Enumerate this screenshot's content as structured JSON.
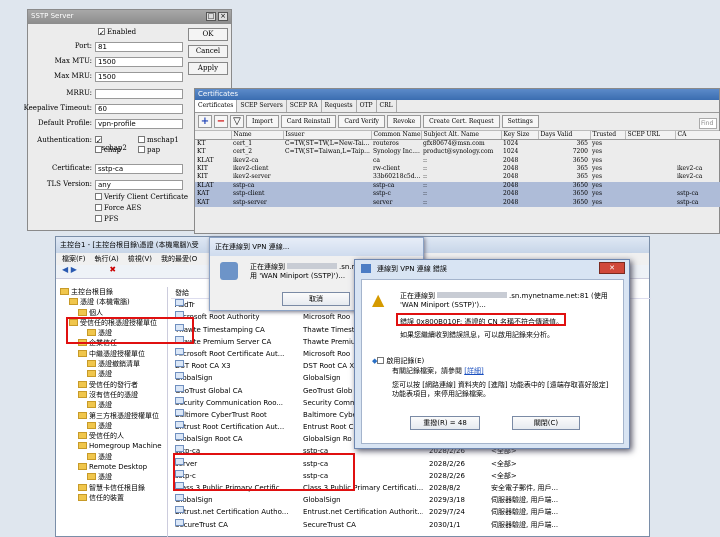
{
  "sstp": {
    "title": "SSTP Server",
    "enabled_label": "Enabled",
    "port_label": "Port:",
    "port": "81",
    "max_mtu_label": "Max MTU:",
    "max_mtu": "1500",
    "max_mru_label": "Max MRU:",
    "max_mru": "1500",
    "mrru_label": "MRRU:",
    "keepalive_label": "Keepalive Timeout:",
    "keepalive": "60",
    "default_profile_label": "Default Profile:",
    "default_profile": "vpn-profile",
    "auth_label": "Authentication:",
    "auth_mschap2": "mschap2",
    "auth_mschap1": "mschap1",
    "auth_chap": "chap",
    "auth_pap": "pap",
    "certificate_label": "Certificate:",
    "certificate": "sstp-ca",
    "tls_label": "TLS Version:",
    "tls": "any",
    "verify_label": "Verify Client Certificate",
    "force_aes_label": "Force AES",
    "pfs_label": "PFS",
    "ok": "OK",
    "cancel": "Cancel",
    "apply": "Apply"
  },
  "certs": {
    "title": "Certificates",
    "tabs": [
      "Certificates",
      "SCEP Servers",
      "SCEP RA",
      "Requests",
      "OTP",
      "CRL"
    ],
    "buttons": [
      "Import",
      "Card Reinstall",
      "Card Verify",
      "Revoke",
      "Create Cert. Request",
      "Settings"
    ],
    "find": "Find",
    "columns": [
      "",
      "Name",
      "Issuer",
      "Common Name",
      "Subject Alt. Name",
      "Key Size",
      "Days Valid",
      "Trusted",
      "SCEP URL",
      "CA"
    ],
    "rows": [
      [
        "KT",
        "cert_1",
        "C=TW,ST=TW,L=New-Tai...",
        "routeros",
        "gfx80674@msn.com",
        "1024",
        "365",
        "yes",
        "",
        ""
      ],
      [
        "KT",
        "cert_2",
        "C=TW,ST=Taiwan,L=Taip...",
        "Synology Inc....",
        "product@synology.com",
        "1024",
        "7200",
        "yes",
        "",
        ""
      ],
      [
        "KLAT",
        "ikev2-ca",
        "",
        "ca",
        "::",
        "2048",
        "3650",
        "yes",
        "",
        ""
      ],
      [
        "KIT",
        "ikev2-client",
        "",
        "rw-client",
        "::",
        "2048",
        "365",
        "yes",
        "",
        "ikev2-ca"
      ],
      [
        "KIT",
        "ikev2-server",
        "",
        "33b60218c5d...",
        "::",
        "2048",
        "365",
        "yes",
        "",
        "ikev2-ca"
      ],
      [
        "KLAT",
        "sstp-ca",
        "",
        "sstp-ca",
        "::",
        "2048",
        "3650",
        "yes",
        "",
        ""
      ],
      [
        "KAT",
        "sstp-client",
        "",
        "sstp-c",
        "::",
        "2048",
        "3650",
        "yes",
        "",
        "sstp-ca"
      ],
      [
        "KAT",
        "sstp-server",
        "",
        "server",
        "::",
        "2048",
        "3650",
        "yes",
        "",
        "sstp-ca"
      ]
    ]
  },
  "mmc": {
    "title": "主控台1 - [主控台根目錄\\憑證 (本機電腦)\\受",
    "menu": [
      "檔案(F)",
      "執行(A)",
      "檢視(V)",
      "我的最愛(O"
    ],
    "tree": [
      "主控台根目錄",
      "憑證 (本機電腦)",
      "個人",
      "受信任的根憑證授權單位",
      "憑證",
      "企業信任",
      "中繼憑證授權單位",
      "憑證撤銷清單",
      "憑證",
      "受信任的發行者",
      "沒有信任的憑證",
      "憑證",
      "第三方根憑證授權單位",
      "憑證",
      "受信任的人",
      "Homegroup Machine",
      "憑證",
      "Remote Desktop",
      "憑證",
      "智慧卡信任根目錄",
      "信任的裝置"
    ],
    "list_header": "發給",
    "list": [
      [
        "AddTr",
        "",
        "",
        ""
      ],
      [
        "Microsoft Root Authority",
        "Microsoft Roo",
        "",
        ""
      ],
      [
        "Thawte Timestamping CA",
        "Thawte Timest",
        "",
        ""
      ],
      [
        "Thawte Premium Server CA",
        "Thawte Premiu",
        "",
        ""
      ],
      [
        "Microsoft Root Certificate Aut...",
        "Microsoft Roo",
        "",
        ""
      ],
      [
        "DST Root CA X3",
        "DST Root CA X",
        "",
        ""
      ],
      [
        "GlobalSign",
        "GlobalSign",
        "",
        ""
      ],
      [
        "GeoTrust Global CA",
        "GeoTrust Glob",
        "",
        ""
      ],
      [
        "Security Communication Roo...",
        "Security Comm",
        "",
        ""
      ],
      [
        "Baltimore CyberTrust Root",
        "Baltimore Cybe",
        "",
        ""
      ],
      [
        "Entrust Root Certification Aut...",
        "Entrust Root C",
        "",
        ""
      ],
      [
        "GlobalSign Root CA",
        "GlobalSign Ro",
        "",
        ""
      ],
      [
        "sstp-ca",
        "sstp-ca",
        "2028/2/26",
        "<全部>"
      ],
      [
        "server",
        "sstp-ca",
        "2028/2/26",
        "<全部>"
      ],
      [
        "sstp-c",
        "sstp-ca",
        "2028/2/26",
        "<全部>"
      ],
      [
        "Class 3 Public Primary Certific...",
        "Class 3 Public Primary Certificati...",
        "2028/8/2",
        "安全電子郵件, 用戶..."
      ],
      [
        "GlobalSign",
        "GlobalSign",
        "2029/3/18",
        "伺服器驗證, 用戶端..."
      ],
      [
        "Entrust.net Certification Autho...",
        "Entrust.net Certification Authorit...",
        "2029/7/24",
        "伺服器驗證, 用戶端..."
      ],
      [
        "SecureTrust CA",
        "SecureTrust CA",
        "2030/1/1",
        "伺服器驗證, 用戶端..."
      ]
    ]
  },
  "progress": {
    "title": "正在連線到 VPN 連線...",
    "line1": "正在連線到",
    "line1b": ".sn.mynetname.net:81 (使",
    "line2": "用 'WAN Miniport (SSTP)')...",
    "cancel": "取消"
  },
  "error": {
    "title": "連線到 VPN 連線 錯誤",
    "connecting_prefix": "正在連線到",
    "connecting_suffix": ".sn.mynetname.net:81 (使用 'WAN Miniport (SSTP)')...",
    "error_msg": "錯誤 0x800B010F: 憑證的 CN 名稱不符合傳遞值。",
    "help": "如果您繼續收到錯誤訊息，可以啟用記錄來分析。",
    "enable_log": "啟用記錄(E)",
    "enable_log_note": "有關記錄檔案，請參閱",
    "details_link": "[詳細]",
    "config_note": "您可以按 [網路連線] 資料夾的 [進階] 功能表中的 [遠端存取喜好設定] 功能表項目，來停用記錄檔案。",
    "redial": "重撥(R) = 48",
    "close": "關閉(C)"
  }
}
